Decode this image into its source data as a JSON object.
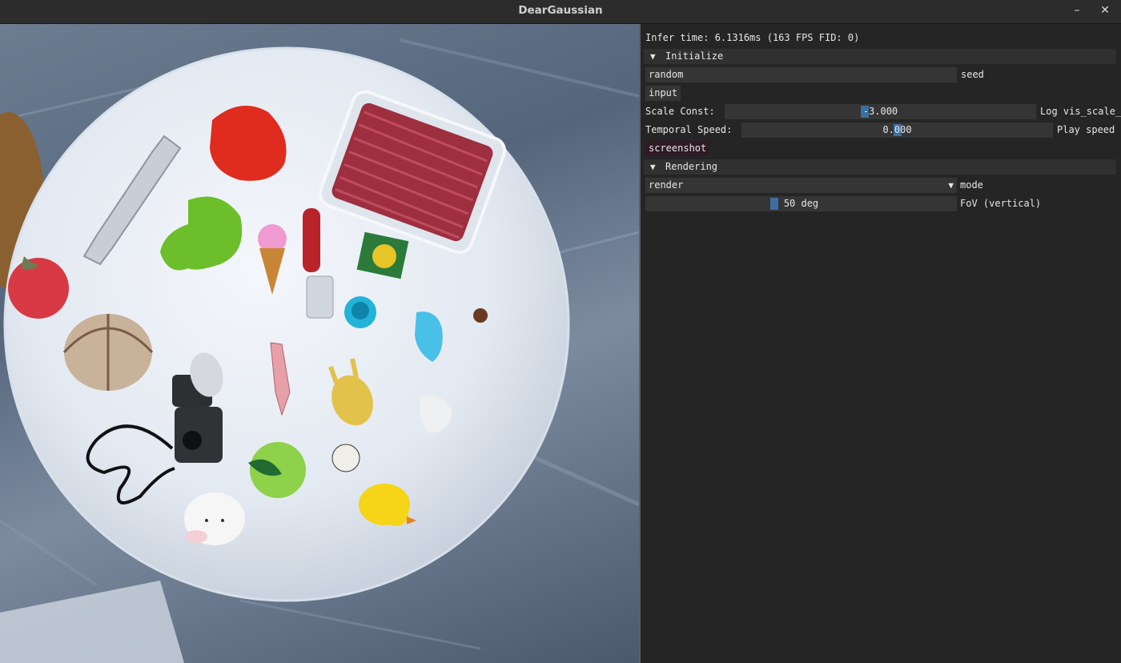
{
  "window": {
    "title": "DearGaussian",
    "minimize_glyph": "–",
    "close_glyph": "✕"
  },
  "panel": {
    "infer_time": "Infer time:  6.1316ms (163 FPS FID: 0)",
    "initialize": {
      "header": "Initialize",
      "arrow": "▼",
      "seed_value": "random",
      "seed_label": "seed",
      "input_button": "input",
      "scale_const_label": "Scale Const:",
      "scale_const_value": "-3.000",
      "scale_const_fraction": 0.45,
      "scale_side_label": "Log vis_scale_",
      "temporal_label": "Temporal Speed:",
      "temporal_value": "0.000",
      "temporal_fraction": 0.5,
      "temporal_side_label": "Play speed",
      "screenshot_button": "screenshot"
    },
    "rendering": {
      "header": "Rendering",
      "arrow": "▼",
      "mode_value": "render",
      "mode_label": "mode",
      "dropdown_glyph": "▼",
      "fov_value": "50 deg",
      "fov_fraction": 0.41,
      "fov_label": "FoV (vertical)"
    }
  },
  "colors": {
    "accent": "#3c6fa0",
    "panel_bg": "#252525",
    "frame_bg": "#353535",
    "header_bg": "#303030"
  },
  "icons": {
    "minimize": "minimize-icon",
    "close": "close-icon",
    "collapse": "triangle-down-icon"
  }
}
